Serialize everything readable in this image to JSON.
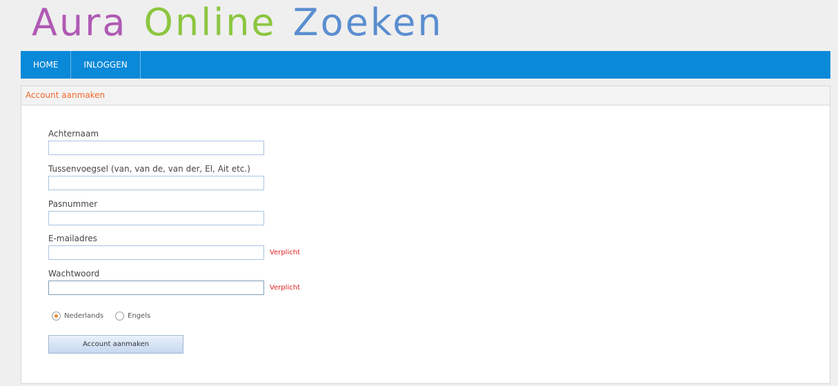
{
  "logo": {
    "word1": "Aura",
    "word2": "Online",
    "word3": "Zoeken",
    "colors": {
      "word1": "#b05ab4",
      "word2": "#8cc63f",
      "word3": "#5b8ed0"
    }
  },
  "nav": {
    "items": [
      {
        "label": "HOME"
      },
      {
        "label": "INLOGGEN"
      }
    ],
    "color": "#0a89d9"
  },
  "panel": {
    "title": "Account aanmaken"
  },
  "form": {
    "fields": [
      {
        "label": "Achternaam",
        "value": "",
        "required_text": ""
      },
      {
        "label": "Tussenvoegsel (van, van de, van der, El, Ait etc.)",
        "value": "",
        "required_text": ""
      },
      {
        "label": "Pasnummer",
        "value": "",
        "required_text": ""
      },
      {
        "label": "E-mailadres",
        "value": "",
        "required_text": "Verplicht"
      },
      {
        "label": "Wachtwoord",
        "value": "",
        "required_text": "Verplicht"
      }
    ],
    "languages": [
      {
        "label": "Nederlands",
        "selected": true
      },
      {
        "label": "Engels",
        "selected": false
      }
    ],
    "submit_label": "Account aanmaken"
  }
}
